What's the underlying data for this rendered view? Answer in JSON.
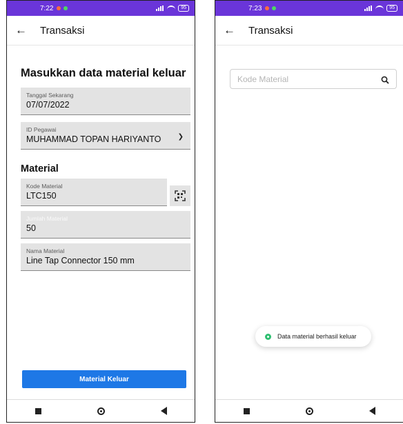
{
  "left_screen": {
    "status_time": "7:22",
    "battery": "95",
    "title": "Transaksi",
    "heading": "Masukkan data material keluar",
    "fields": {
      "tanggal": {
        "label": "Tanggal Sekarang",
        "value": "07/07/2022"
      },
      "pegawai": {
        "label": "ID Pegawai",
        "value": "MUHAMMAD TOPAN HARIYANTO"
      },
      "kode": {
        "label": "Kode Material",
        "value": "LTC150"
      },
      "jumlah": {
        "label": "Jumlah Material",
        "value": "50"
      },
      "nama": {
        "label": "Nama Material",
        "value": "Line Tap Connector 150 mm"
      }
    },
    "section_title": "Material",
    "submit_label": "Material Keluar"
  },
  "right_screen": {
    "status_time": "7:23",
    "battery": "95",
    "title": "Transaksi",
    "search_placeholder": "Kode Material",
    "toast_text": "Data material berhasil keluar"
  },
  "colors": {
    "status_bar": "#6a35d9",
    "primary_button": "#1e78e6",
    "toast_icon": "#2fbf71"
  },
  "icons": {
    "back": "arrow-left-icon",
    "dropdown": "chevron-down-icon",
    "scan": "qr-scan-icon",
    "search": "search-icon",
    "success": "check-circle-icon"
  }
}
